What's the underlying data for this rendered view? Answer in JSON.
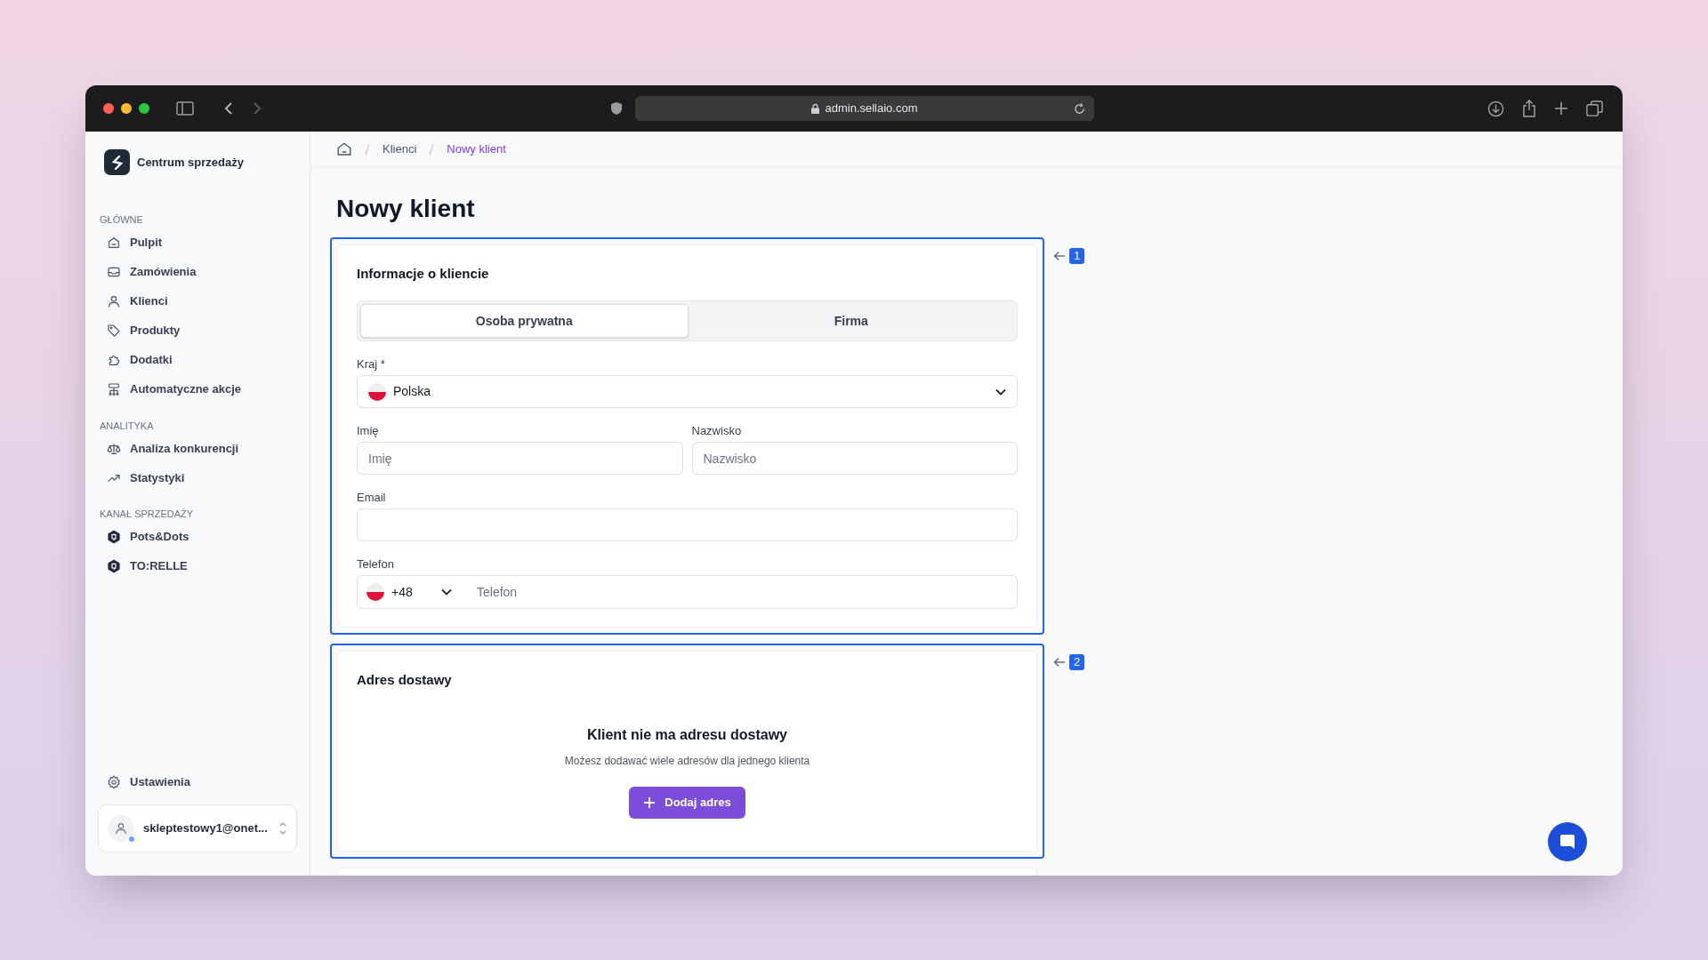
{
  "browser": {
    "url": "admin.sellaio.com"
  },
  "sidebar": {
    "brand": "Centrum sprzedaży",
    "sections": [
      {
        "title": "GŁÓWNE",
        "items": [
          {
            "label": "Pulpit",
            "selected": false
          },
          {
            "label": "Zamówienia",
            "selected": false
          },
          {
            "label": "Klienci",
            "selected": false
          },
          {
            "label": "Produkty",
            "selected": false
          },
          {
            "label": "Dodatki",
            "selected": false
          },
          {
            "label": "Automatyczne akcje",
            "selected": false
          }
        ]
      },
      {
        "title": "ANALITYKA",
        "items": [
          {
            "label": "Analiza konkurencji",
            "selected": false
          },
          {
            "label": "Statystyki",
            "selected": false
          }
        ]
      },
      {
        "title": "KANAŁ SPRZEDAŻY",
        "items": [
          {
            "label": "Pots&Dots",
            "selected": false
          },
          {
            "label": "TO:RELLE",
            "selected": false
          }
        ]
      }
    ],
    "settings": "Ustawienia",
    "account": {
      "email": "skleptestowy1@onet..."
    }
  },
  "breadcrumb": [
    {
      "label": "Klienci",
      "current": false
    },
    {
      "label": "Nowy klient",
      "current": true
    }
  ],
  "page_title": "Nowy klient",
  "client_card": {
    "callout": "1",
    "title": "Informacje o kliencie",
    "tabs": [
      {
        "label": "Osoba prywatna",
        "selected": true
      },
      {
        "label": "Firma",
        "selected": false
      }
    ],
    "country": {
      "label": "Kraj *",
      "value": "Polska"
    },
    "first_name": {
      "label": "Imię",
      "placeholder": "Imię"
    },
    "last_name": {
      "label": "Nazwisko",
      "placeholder": "Nazwisko"
    },
    "email": {
      "label": "Email"
    },
    "phone": {
      "label": "Telefon",
      "code": "+48",
      "placeholder": "Telefon"
    }
  },
  "address_card": {
    "callout": "2",
    "title": "Adres dostawy",
    "empty_title": "Klient nie ma adresu dostawy",
    "empty_text": "Możesz dodawać wiele adresów dla jednego klienta",
    "button": "Dodaj adres"
  }
}
